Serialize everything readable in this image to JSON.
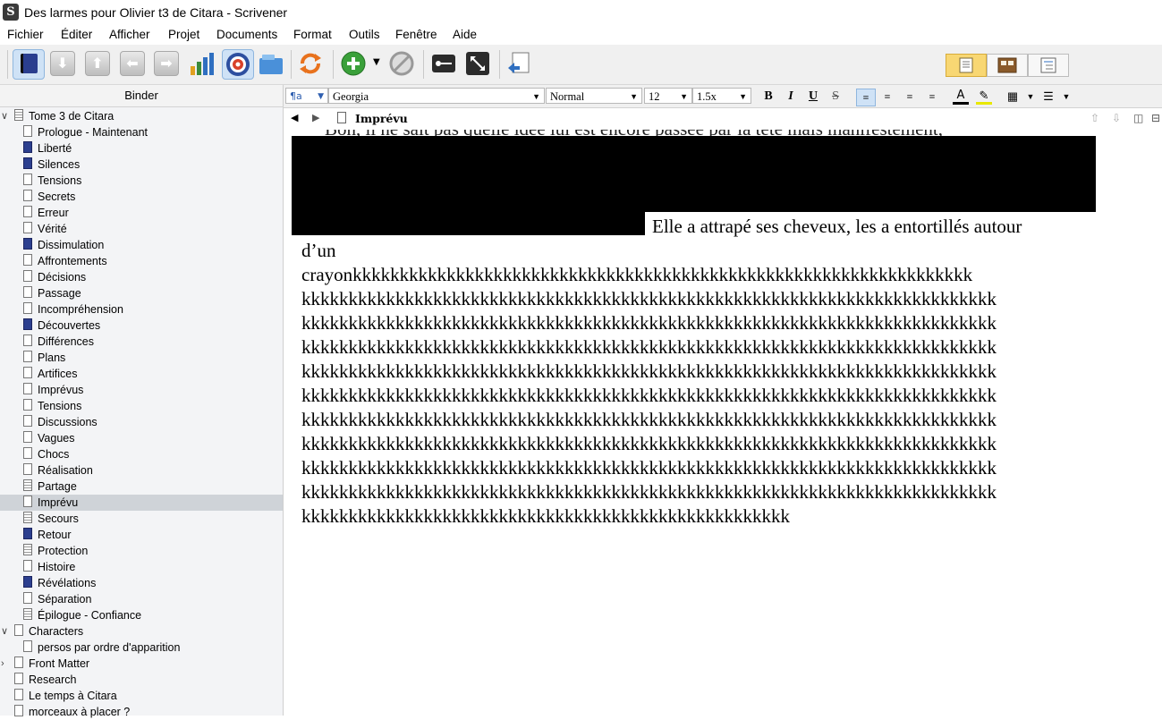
{
  "window": {
    "title": "Des larmes pour Olivier t3 de Citara - Scrivener",
    "app_icon": "scrivener-icon"
  },
  "menu": [
    "Fichier",
    "Éditer",
    "Afficher",
    "Projet",
    "Documents",
    "Format",
    "Outils",
    "Fenêtre",
    "Aide"
  ],
  "toolbar": {
    "icons": [
      "binder-icon",
      "move-down-icon",
      "move-up-icon",
      "move-left-icon",
      "move-right-icon",
      "statistics-icon",
      "targets-icon",
      "collections-icon",
      "sync-icon",
      "add-icon",
      "dropdown-icon",
      "delete-icon",
      "keywords-icon",
      "fullscreen-icon",
      "compile-icon"
    ],
    "view_modes": [
      "document-view-icon",
      "corkboard-view-icon",
      "outline-view-icon"
    ]
  },
  "binder": {
    "header": "Binder",
    "root": "Tome 3 de Citara",
    "items": [
      {
        "label": "Prologue - Maintenant",
        "kind": "text"
      },
      {
        "label": "Liberté",
        "kind": "blue"
      },
      {
        "label": "Silences",
        "kind": "blue"
      },
      {
        "label": "Tensions",
        "kind": "text"
      },
      {
        "label": "Secrets",
        "kind": "text"
      },
      {
        "label": "Erreur",
        "kind": "text"
      },
      {
        "label": "Vérité",
        "kind": "text"
      },
      {
        "label": "Dissimulation",
        "kind": "blue"
      },
      {
        "label": "Affrontements",
        "kind": "text"
      },
      {
        "label": "Décisions",
        "kind": "text"
      },
      {
        "label": "Passage",
        "kind": "text"
      },
      {
        "label": "Incompréhension",
        "kind": "text"
      },
      {
        "label": "Découvertes",
        "kind": "blue"
      },
      {
        "label": "Différences",
        "kind": "text"
      },
      {
        "label": "Plans",
        "kind": "text"
      },
      {
        "label": "Artifices",
        "kind": "text"
      },
      {
        "label": "Imprévus",
        "kind": "text"
      },
      {
        "label": "Tensions",
        "kind": "text"
      },
      {
        "label": "Discussions",
        "kind": "text"
      },
      {
        "label": "Vagues",
        "kind": "text"
      },
      {
        "label": "Chocs",
        "kind": "text"
      },
      {
        "label": "Réalisation",
        "kind": "text"
      },
      {
        "label": "Partage",
        "kind": "lines"
      },
      {
        "label": "Imprévu",
        "kind": "text",
        "selected": true
      },
      {
        "label": "Secours",
        "kind": "lines"
      },
      {
        "label": "Retour",
        "kind": "blue"
      },
      {
        "label": "Protection",
        "kind": "lines"
      },
      {
        "label": "Histoire",
        "kind": "text"
      },
      {
        "label": "Révélations",
        "kind": "blue"
      },
      {
        "label": "Séparation",
        "kind": "text"
      },
      {
        "label": "Épilogue - Confiance",
        "kind": "lines"
      }
    ],
    "characters": "Characters",
    "characters_child": "persos par ordre d'apparition",
    "front_matter": "Front Matter",
    "research": "Research",
    "extra1": "Le temps à Citara",
    "extra2": "morceaux à placer ?"
  },
  "format_bar": {
    "style_marker": "¶a",
    "font": "Georgia",
    "style": "Normal",
    "size": "12",
    "spacing": "1.5x",
    "bold": "B",
    "italic": "I",
    "underline": "U",
    "strike": "S"
  },
  "doc_header": {
    "title": "Imprévu"
  },
  "editor": {
    "partial_top": "Bon, il ne sait pas quelle idée lui est encore passée par la tête mais manifestement,",
    "visible_fragment": "Elle a attrapé ses cheveux, les a entortillés autour",
    "line2": "d’un",
    "line3": "crayonkkkkkkkkkkkkkkkkkkkkkkkkkkkkkkkkkkkkkkkkkkkkkkkkkkkkkkkkkkkkkkkkkk",
    "k_line": "kkkkkkkkkkkkkkkkkkkkkkkkkkkkkkkkkkkkkkkkkkkkkkkkkkkkkkkkkkkkkkkkkkkkkkkkkk",
    "last_line": "kkkkkkkkkkkkkkkkkkkkkkkkkkkkkkkkkkkkkkkkkkkkkkkkkkkk"
  }
}
